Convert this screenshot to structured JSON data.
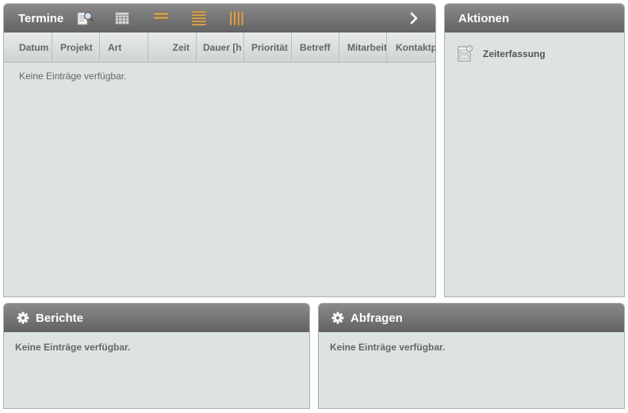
{
  "termine": {
    "title": "Termine",
    "toolbar_icons": [
      "search-document-icon",
      "calendar-grid-icon",
      "two-lines-view-icon",
      "list-view-icon",
      "columns-view-icon"
    ],
    "next_icon": "chevron-right-icon",
    "columns": [
      "Datum",
      "Projekt",
      "Art",
      "Zeit",
      "Dauer [h",
      "Priorität",
      "Betreff",
      "Mitarbeit",
      "Kontaktp"
    ],
    "empty_text": "Keine Einträge verfügbar."
  },
  "aktionen": {
    "title": "Aktionen",
    "items": [
      {
        "label": "Zeiterfassung",
        "icon": "time-entry-icon"
      }
    ]
  },
  "berichte": {
    "title": "Berichte",
    "icon": "gear-icon",
    "empty_text": "Keine Einträge verfügbar."
  },
  "abfragen": {
    "title": "Abfragen",
    "icon": "gear-icon",
    "empty_text": "Keine Einträge verfügbar."
  },
  "colors": {
    "header_top": "#8a8a8a",
    "header_bottom": "#626262",
    "panel_bg": "#dde3e3",
    "toolbar_accent": "#d7a75a"
  }
}
